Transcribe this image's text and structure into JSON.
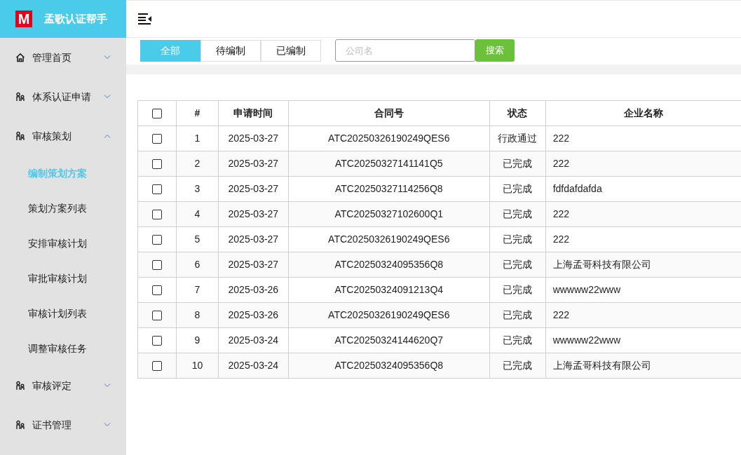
{
  "app": {
    "logo": "M",
    "title": "孟歌认证帮手"
  },
  "sidebar": {
    "items": [
      {
        "label": "管理首页",
        "kind": "home",
        "expanded": false
      },
      {
        "label": "体系认证申请",
        "kind": "group",
        "expanded": false
      },
      {
        "label": "审核策划",
        "kind": "group",
        "expanded": true,
        "children": [
          {
            "label": "编制策划方案",
            "selected": true
          },
          {
            "label": "策划方案列表",
            "selected": false
          },
          {
            "label": "安排审核计划",
            "selected": false
          },
          {
            "label": "审批审核计划",
            "selected": false
          },
          {
            "label": "审核计划列表",
            "selected": false
          },
          {
            "label": "调整审核任务",
            "selected": false
          }
        ]
      },
      {
        "label": "审核评定",
        "kind": "group",
        "expanded": false
      },
      {
        "label": "证书管理",
        "kind": "group",
        "expanded": false
      }
    ]
  },
  "filters": {
    "tabs": [
      {
        "label": "全部",
        "selected": true
      },
      {
        "label": "待编制",
        "selected": false
      },
      {
        "label": "已编制",
        "selected": false
      }
    ],
    "search": {
      "placeholder": "公司名"
    },
    "search_button": "搜索"
  },
  "table": {
    "select_all": false,
    "columns": [
      "#",
      "申请时间",
      "合同号",
      "状态",
      "企业名称"
    ],
    "rows": [
      {
        "checked": false,
        "cells": [
          "1",
          "2025-03-27",
          "ATC20250326190249QES6",
          "行政通过",
          "222"
        ]
      },
      {
        "checked": false,
        "cells": [
          "2",
          "2025-03-27",
          "ATC20250327141141Q5",
          "已完成",
          "222"
        ]
      },
      {
        "checked": false,
        "cells": [
          "3",
          "2025-03-27",
          "ATC20250327114256Q8",
          "已完成",
          "fdfdafdafda"
        ]
      },
      {
        "checked": false,
        "cells": [
          "4",
          "2025-03-27",
          "ATC20250327102600Q1",
          "已完成",
          "222"
        ]
      },
      {
        "checked": false,
        "cells": [
          "5",
          "2025-03-27",
          "ATC20250326190249QES6",
          "已完成",
          "222"
        ]
      },
      {
        "checked": false,
        "cells": [
          "6",
          "2025-03-27",
          "ATC20250324095356Q8",
          "已完成",
          "上海孟哥科技有限公司"
        ]
      },
      {
        "checked": false,
        "cells": [
          "7",
          "2025-03-26",
          "ATC20250324091213Q4",
          "已完成",
          "wwwww22www"
        ]
      },
      {
        "checked": false,
        "cells": [
          "8",
          "2025-03-26",
          "ATC20250326190249QES6",
          "已完成",
          "222"
        ]
      },
      {
        "checked": false,
        "cells": [
          "9",
          "2025-03-24",
          "ATC20250324144620Q7",
          "已完成",
          "wwwww22www"
        ]
      },
      {
        "checked": false,
        "cells": [
          "10",
          "2025-03-24",
          "ATC20250324095356Q8",
          "已完成",
          "上海孟哥科技有限公司"
        ]
      }
    ]
  }
}
